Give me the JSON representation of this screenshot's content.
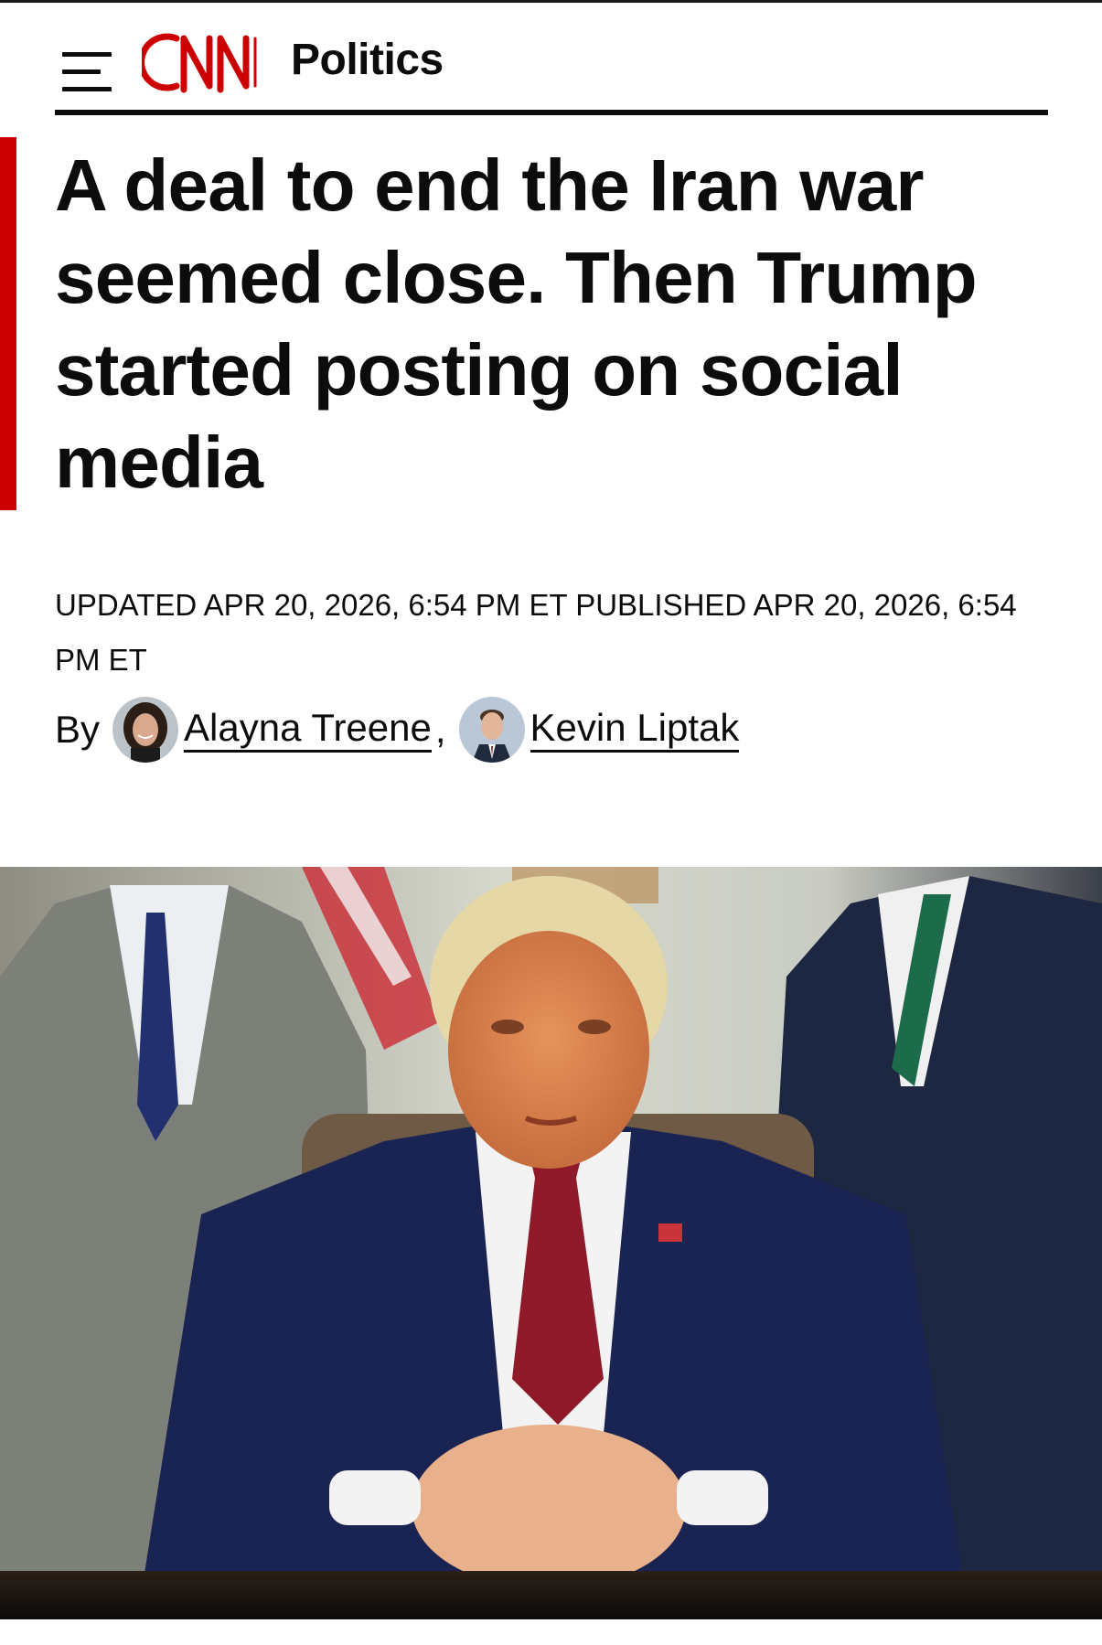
{
  "header": {
    "menu_icon": "hamburger-menu-icon",
    "logo_text": "CNN",
    "section": "Politics"
  },
  "article": {
    "headline": "A deal to end the Iran war seemed close. Then Trump started posting on social media",
    "timestamp": "UPDATED APR 20, 2026, 6:54 PM ET PUBLISHED APR 20, 2026, 6:54 PM ET",
    "byline_prefix": "By",
    "authors": [
      {
        "name": "Alayna Treene"
      },
      {
        "name": "Kevin Liptak"
      }
    ],
    "separator": ","
  },
  "colors": {
    "brand_red": "#cc0000",
    "text": "#0c0c0c",
    "background": "#ffffff"
  }
}
